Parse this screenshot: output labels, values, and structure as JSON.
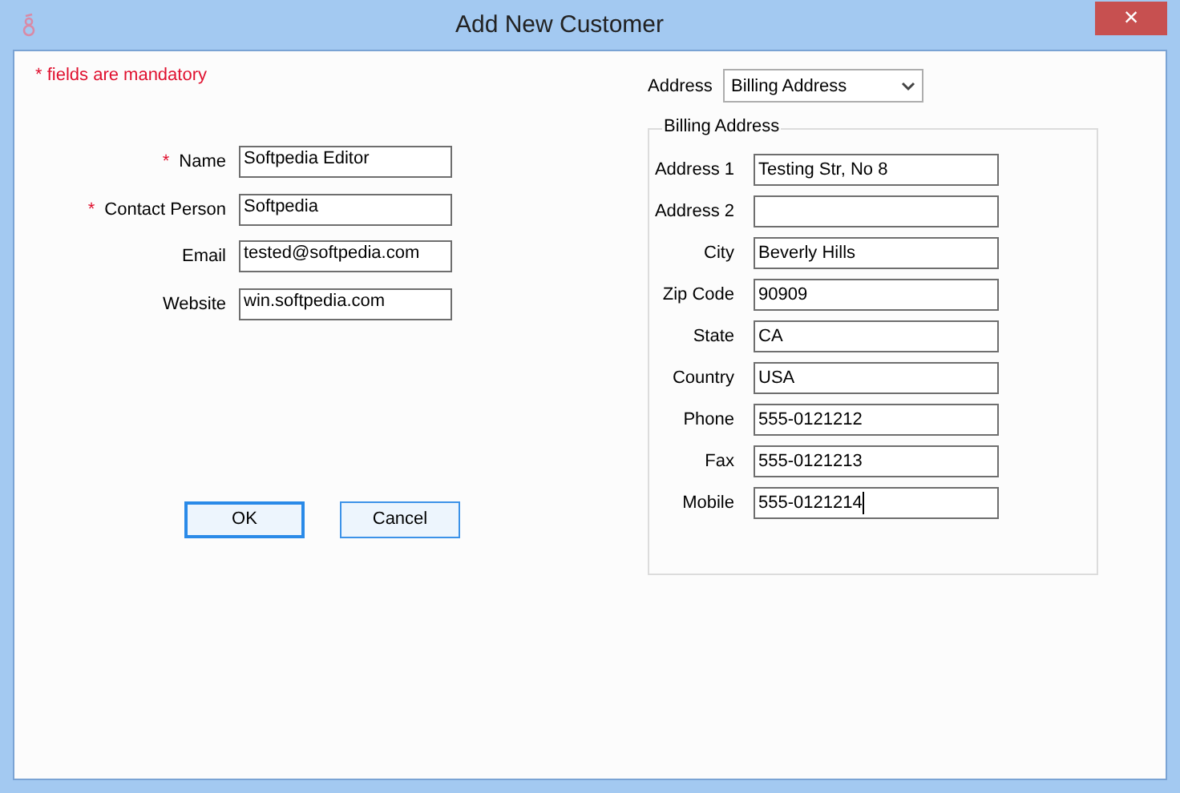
{
  "window": {
    "title": "Add New Customer",
    "close": "×"
  },
  "note": {
    "mark": "*",
    "text": "fields are mandatory"
  },
  "customer_fields": [
    {
      "label": "Name",
      "value": "Softpedia Editor",
      "required": true
    },
    {
      "label": "Contact Person",
      "value": "Softpedia",
      "required": true
    },
    {
      "label": "Email",
      "value": "tested@softpedia.com",
      "required": false
    },
    {
      "label": "Website",
      "value": "win.softpedia.com",
      "required": false
    }
  ],
  "buttons": [
    {
      "label": "OK",
      "default": true
    },
    {
      "label": "Cancel",
      "default": false
    }
  ],
  "address_selector": {
    "label": "Address",
    "value": "Billing Address"
  },
  "address_group": {
    "title": "Billing Address",
    "fields": [
      {
        "label": "Address 1",
        "value": "Testing Str, No 8",
        "focused": false
      },
      {
        "label": "Address 2",
        "focused": false
      },
      {
        "label": "City",
        "value": "Beverly Hills",
        "focused": false
      },
      {
        "label": "Zip Code",
        "value": "90909",
        "focused": false
      },
      {
        "label": "State",
        "value": "CA",
        "focused": false
      },
      {
        "label": "Country",
        "value": "USA",
        "focused": false
      },
      {
        "label": "Phone",
        "value": "555-0121212",
        "focused": false
      },
      {
        "label": "Fax",
        "value": "555-0121213",
        "focused": false
      },
      {
        "label": "Mobile",
        "value": "555-0121214",
        "focused": true
      }
    ]
  }
}
